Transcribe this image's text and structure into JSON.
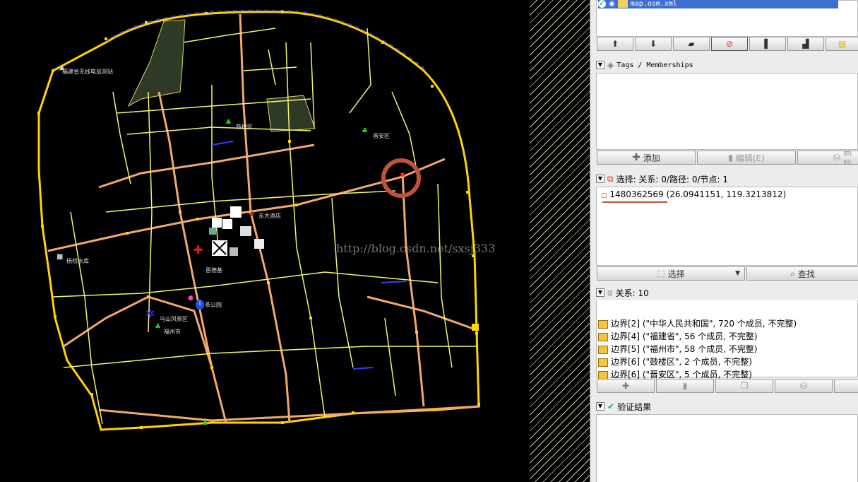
{
  "layers": {
    "file": "map.osm.xml"
  },
  "tags_panel": {
    "title": "Tags / Memberships",
    "add": "添加",
    "edit": "编辑(E)",
    "delete": "删除"
  },
  "selection_panel": {
    "title": "选择: 关系: 0/路径: 0/节点: 1",
    "node_id": "1480362569",
    "node_coords": "(26.0941151, 119.3213812)",
    "select": "选择",
    "find": "查找"
  },
  "relation_panel": {
    "title": "关系: 10",
    "items": [
      "边界[2] (\"中华人民共和国\", 720 个成员, 不完整)",
      "边界[4] (\"福建省\", 56 个成员, 不完整)",
      "边界[5] (\"福州市\", 58 个成员, 不完整)",
      "边界[6] (\"鼓楼区\", 2 个成员, 不完整)",
      "边界[6] (\"晋安区\", 5 个成员, 不完整)"
    ]
  },
  "validation_panel": {
    "title": "验证结果"
  },
  "map": {
    "watermark": "http://blog.csdn.net/sxsj333",
    "labels": [
      "福建省无线电监测站",
      "鼓楼区",
      "晋安区",
      "杨桥水库",
      "乌山风景区",
      "福州市",
      "东大酒店",
      "晋德基",
      "茶公园"
    ]
  },
  "colors": {
    "road_major": "#f2a96a",
    "road_minor": "#f5f56a",
    "node": "#ffd400",
    "boundary": "#4a3aa6",
    "highlight": "#c0523a"
  }
}
